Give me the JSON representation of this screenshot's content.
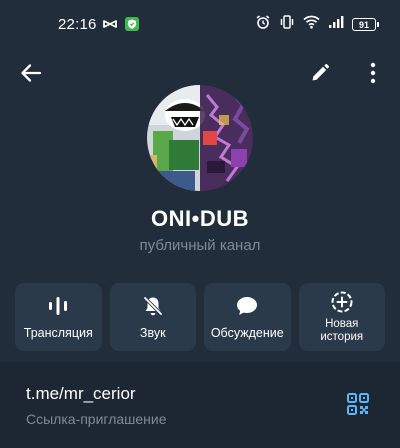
{
  "status_bar": {
    "time": "22:16",
    "battery": "91",
    "left_icons": [
      "capcut-icon",
      "shield-check-icon"
    ],
    "right_icons": [
      "alarm-icon",
      "vibrate-icon",
      "wifi-icon",
      "signal-icon",
      "battery-icon"
    ]
  },
  "app_bar": {
    "back_icon": "arrow-left-icon",
    "edit_icon": "pencil-icon",
    "more_icon": "more-vertical-icon"
  },
  "profile": {
    "title": "ONI•DUB",
    "subtitle": "публичный канал"
  },
  "actions": [
    {
      "label": "Трансляция",
      "icon": "live-stream-icon"
    },
    {
      "label": "Звук",
      "icon": "bell-off-icon"
    },
    {
      "label": "Обсуждение",
      "icon": "chat-bubble-icon"
    },
    {
      "label": "Новая история",
      "icon": "add-story-icon"
    }
  ],
  "link": {
    "url": "t.me/mr_cerior",
    "caption": "Ссылка-приглашение",
    "qr_icon": "qr-code-icon"
  },
  "colors": {
    "background": "#212d3b",
    "card": "#2b3a4a",
    "accent": "#5eb5f7",
    "muted": "#7d8b99"
  }
}
